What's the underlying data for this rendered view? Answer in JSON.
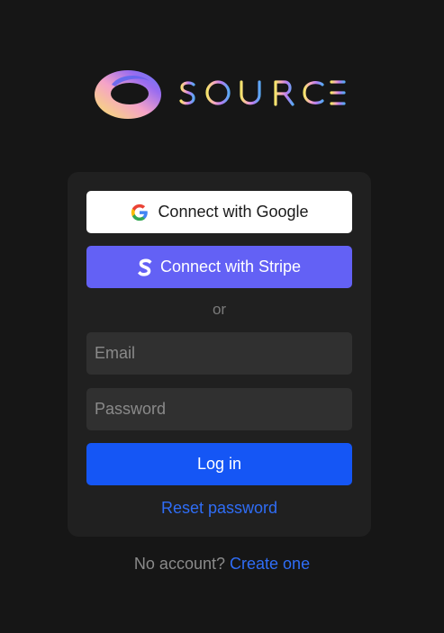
{
  "brand": {
    "name": "SOURCE",
    "logo_icon": "source-ring-logo-icon",
    "gradient": [
      "#f7e36b",
      "#f29bd0",
      "#8f6bf2",
      "#5da8f5"
    ]
  },
  "auth": {
    "google_button": "Connect with Google",
    "google_icon": "google-icon",
    "stripe_button": "Connect with Stripe",
    "stripe_icon": "stripe-icon",
    "divider": "or",
    "email_placeholder": "Email",
    "password_placeholder": "Password",
    "login_button": "Log in",
    "reset_link": "Reset password"
  },
  "footer": {
    "prompt": "No account?",
    "create_link": "Create one"
  },
  "colors": {
    "background": "#161616",
    "card": "#202020",
    "stripe": "#6361f5",
    "primary": "#1556f5",
    "link": "#2f6df6"
  }
}
